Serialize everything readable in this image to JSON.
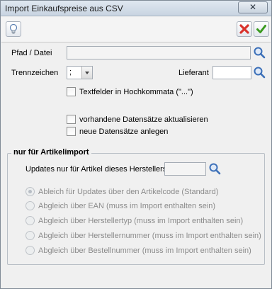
{
  "window": {
    "title": "Import Einkaufspreise aus CSV",
    "close_symbol": "✕"
  },
  "toolbar": {
    "hint_icon": "lightbulb-icon",
    "cancel_icon": "red-x-icon",
    "confirm_icon": "green-check-icon"
  },
  "form": {
    "path_label": "Pfad / Datei",
    "path_value": "",
    "separator_label": "Trennzeichen",
    "separator_value": ";",
    "supplier_label": "Lieferant",
    "supplier_value": "",
    "quoted_fields_label": "Textfelder in Hochkommata (\"...\")",
    "quoted_fields_checked": false,
    "update_existing_label": "vorhandene Datensätze aktualisieren",
    "update_existing_checked": false,
    "create_new_label": "neue Datensätze anlegen",
    "create_new_checked": false
  },
  "article_import": {
    "group_title": "nur für Artikelimport",
    "manufacturer_label": "Updates nur für Artikel dieses Herstellers",
    "manufacturer_value": "",
    "options": [
      {
        "label": "Ableich für Updates über den Artikelcode (Standard)",
        "checked": true
      },
      {
        "label": "Abgleich über EAN (muss im Import enthalten sein)",
        "checked": false
      },
      {
        "label": "Abgleich über Herstellertyp (muss im Import enthalten sein)",
        "checked": false
      },
      {
        "label": "Abgleich über Herstellernummer (muss im Import enthalten sein)",
        "checked": false
      },
      {
        "label": "Abgleich über Bestellnummer (muss im Import enthalten sein)",
        "checked": false
      }
    ]
  },
  "colors": {
    "accent_cancel": "#d9322b",
    "accent_confirm": "#3a9a1f",
    "search_icon": "#3b6fb8"
  }
}
